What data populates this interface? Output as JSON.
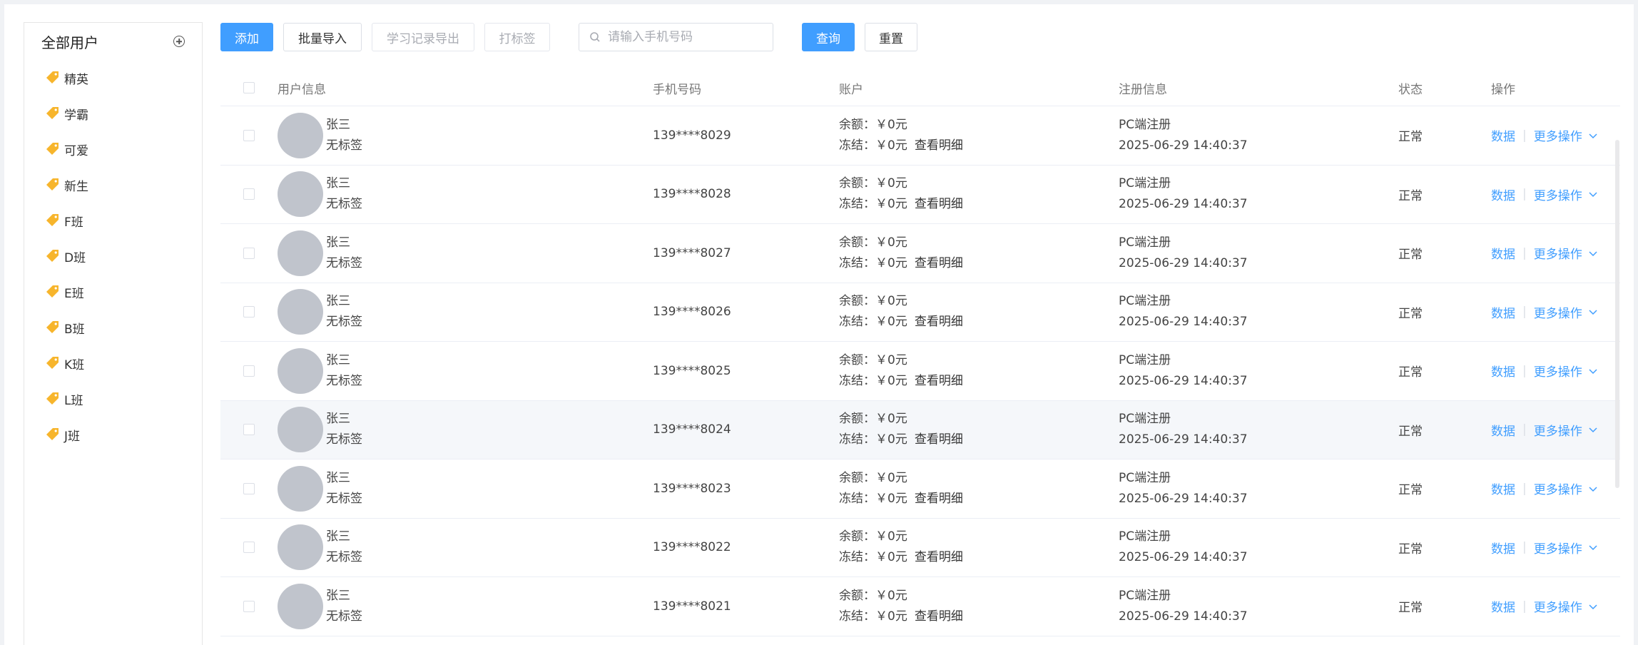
{
  "sidebar": {
    "title": "全部用户",
    "add_icon": "plus-circle-icon",
    "tag_icon": "tag-icon",
    "tag_color": "#f7b52c",
    "items": [
      "精英",
      "学霸",
      "可爱",
      "新生",
      "F班",
      "D班",
      "E班",
      "B班",
      "K班",
      "L班",
      "J班"
    ]
  },
  "toolbar": {
    "add": "添加",
    "import": "批量导入",
    "export": "学习记录导出",
    "tag": "打标签",
    "search_placeholder": "请输入手机号码",
    "query": "查询",
    "reset": "重置"
  },
  "table": {
    "columns": {
      "user": "用户信息",
      "phone": "手机号码",
      "account": "账户",
      "reg": "注册信息",
      "status": "状态",
      "ops": "操作"
    },
    "balance_label": "余额：",
    "frozen_label": "冻结：",
    "detail_link": "查看明细",
    "data_link": "数据",
    "more_link": "更多操作",
    "rows": [
      {
        "name": "张三",
        "tag": "无标签",
        "phone": "139****8029",
        "balance": "￥0元",
        "frozen": "￥0元",
        "reg_source": "PC端注册",
        "reg_time": "2025-06-29 14:40:37",
        "status": "正常"
      },
      {
        "name": "张三",
        "tag": "无标签",
        "phone": "139****8028",
        "balance": "￥0元",
        "frozen": "￥0元",
        "reg_source": "PC端注册",
        "reg_time": "2025-06-29 14:40:37",
        "status": "正常"
      },
      {
        "name": "张三",
        "tag": "无标签",
        "phone": "139****8027",
        "balance": "￥0元",
        "frozen": "￥0元",
        "reg_source": "PC端注册",
        "reg_time": "2025-06-29 14:40:37",
        "status": "正常"
      },
      {
        "name": "张三",
        "tag": "无标签",
        "phone": "139****8026",
        "balance": "￥0元",
        "frozen": "￥0元",
        "reg_source": "PC端注册",
        "reg_time": "2025-06-29 14:40:37",
        "status": "正常"
      },
      {
        "name": "张三",
        "tag": "无标签",
        "phone": "139****8025",
        "balance": "￥0元",
        "frozen": "￥0元",
        "reg_source": "PC端注册",
        "reg_time": "2025-06-29 14:40:37",
        "status": "正常"
      },
      {
        "name": "张三",
        "tag": "无标签",
        "phone": "139****8024",
        "balance": "￥0元",
        "frozen": "￥0元",
        "reg_source": "PC端注册",
        "reg_time": "2025-06-29 14:40:37",
        "status": "正常"
      },
      {
        "name": "张三",
        "tag": "无标签",
        "phone": "139****8023",
        "balance": "￥0元",
        "frozen": "￥0元",
        "reg_source": "PC端注册",
        "reg_time": "2025-06-29 14:40:37",
        "status": "正常"
      },
      {
        "name": "张三",
        "tag": "无标签",
        "phone": "139****8022",
        "balance": "￥0元",
        "frozen": "￥0元",
        "reg_source": "PC端注册",
        "reg_time": "2025-06-29 14:40:37",
        "status": "正常"
      },
      {
        "name": "张三",
        "tag": "无标签",
        "phone": "139****8021",
        "balance": "￥0元",
        "frozen": "￥0元",
        "reg_source": "PC端注册",
        "reg_time": "2025-06-29 14:40:37",
        "status": "正常"
      }
    ]
  }
}
